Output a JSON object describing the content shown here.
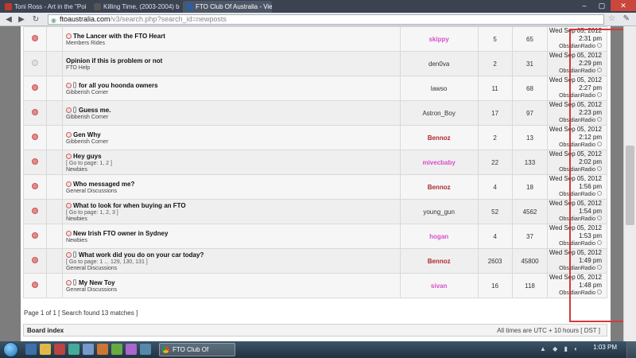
{
  "browser": {
    "tabs": [
      {
        "title": "Toni Ross - Art in the \"Poi",
        "active": false,
        "favicon_color": "#c0392b"
      },
      {
        "title": "Killing Time, (2003-2004) b",
        "active": false,
        "favicon_color": "#555555"
      },
      {
        "title": "FTO Club Of Australia - Vie",
        "active": true,
        "favicon_color": "#2d5fa0"
      }
    ],
    "url_host": "ftoaustralia.com",
    "url_path": "/v3/search.php?search_id=newposts",
    "window_controls": [
      "–",
      "▢",
      "✕"
    ]
  },
  "topics": [
    {
      "title": "The Lancer with the FTO Heart",
      "pages": "",
      "forum": "Members Rides",
      "author": "skippy",
      "author_style": "pink",
      "replies": "5",
      "views": "65",
      "last_date": "Wed Sep 05, 2012",
      "last_time": "2:31 pm",
      "last_author": "ObsidianRadio",
      "unread": true,
      "newpost_icon": true,
      "attach": false
    },
    {
      "title": "Opinion if this is problem or not",
      "pages": "",
      "forum": "FTO Help",
      "author": "den0va",
      "author_style": "normal",
      "replies": "2",
      "views": "31",
      "last_date": "Wed Sep 05, 2012",
      "last_time": "2:29 pm",
      "last_author": "ObsidianRadio",
      "unread": false,
      "newpost_icon": false,
      "attach": false
    },
    {
      "title": "for all you hoonda owners",
      "pages": "",
      "forum": "Gibberish Corner",
      "author": "lawso",
      "author_style": "normal",
      "replies": "11",
      "views": "68",
      "last_date": "Wed Sep 05, 2012",
      "last_time": "2:27 pm",
      "last_author": "ObsidianRadio",
      "unread": true,
      "newpost_icon": true,
      "attach": true
    },
    {
      "title": "Guess me.",
      "pages": "",
      "forum": "Gibberish Corner",
      "author": "Astron_Boy",
      "author_style": "normal",
      "replies": "17",
      "views": "97",
      "last_date": "Wed Sep 05, 2012",
      "last_time": "2:23 pm",
      "last_author": "ObsidianRadio",
      "unread": true,
      "newpost_icon": true,
      "attach": true
    },
    {
      "title": "Gen Why",
      "pages": "",
      "forum": "Gibberish Corner",
      "author": "Bennoz",
      "author_style": "mod",
      "replies": "2",
      "views": "13",
      "last_date": "Wed Sep 05, 2012",
      "last_time": "2:12 pm",
      "last_author": "ObsidianRadio",
      "unread": true,
      "newpost_icon": true,
      "attach": false
    },
    {
      "title": "Hey guys",
      "pages": "[ Go to page: 1, 2 ]",
      "forum": "Newbies",
      "author": "mivecbaby",
      "author_style": "pink",
      "replies": "22",
      "views": "133",
      "last_date": "Wed Sep 05, 2012",
      "last_time": "2:02 pm",
      "last_author": "ObsidianRadio",
      "unread": true,
      "newpost_icon": true,
      "attach": false
    },
    {
      "title": "Who messaged me?",
      "pages": "",
      "forum": "General Discussions",
      "author": "Bennoz",
      "author_style": "mod",
      "replies": "4",
      "views": "18",
      "last_date": "Wed Sep 05, 2012",
      "last_time": "1:56 pm",
      "last_author": "ObsidianRadio",
      "unread": true,
      "newpost_icon": true,
      "attach": false
    },
    {
      "title": "What to look for when buying an FTO",
      "pages": "[ Go to page: 1, 2, 3 ]",
      "forum": "Newbies",
      "author": "young_gun",
      "author_style": "normal",
      "replies": "52",
      "views": "4562",
      "last_date": "Wed Sep 05, 2012",
      "last_time": "1:54 pm",
      "last_author": "ObsidianRadio",
      "unread": true,
      "newpost_icon": true,
      "attach": false
    },
    {
      "title": "New Irish FTO owner in Sydney",
      "pages": "",
      "forum": "Newbies",
      "author": "hogan",
      "author_style": "pink",
      "replies": "4",
      "views": "37",
      "last_date": "Wed Sep 05, 2012",
      "last_time": "1:53 pm",
      "last_author": "ObsidianRadio",
      "unread": true,
      "newpost_icon": true,
      "attach": false
    },
    {
      "title": "What work did you do on your car today?",
      "pages": "[ Go to page: 1 ... 129, 130, 131 ]",
      "forum": "General Discussions",
      "author": "Bennoz",
      "author_style": "mod",
      "replies": "2603",
      "views": "45800",
      "last_date": "Wed Sep 05, 2012",
      "last_time": "1:49 pm",
      "last_author": "ObsidianRadio",
      "unread": true,
      "newpost_icon": true,
      "attach": true
    },
    {
      "title": "My New Toy",
      "pages": "",
      "forum": "General Discussions",
      "author": "sivan",
      "author_style": "pink",
      "replies": "16",
      "views": "118",
      "last_date": "Wed Sep 05, 2012",
      "last_time": "1:48 pm",
      "last_author": "ObsidianRadio",
      "unread": true,
      "newpost_icon": true,
      "attach": true
    }
  ],
  "pagination": "Page 1 of 1 [ Search found 13 matches ]",
  "footer": {
    "board_index": "Board index",
    "timezone": "All times are UTC + 10 hours [ DST ]"
  },
  "taskbar": {
    "task_title": "FTO Club Of Austral...",
    "clock": "1:03 PM"
  },
  "colors": {
    "highlight_border": "#d23a3a",
    "moderator": "#b02828",
    "member_pink": "#d94fcc"
  }
}
